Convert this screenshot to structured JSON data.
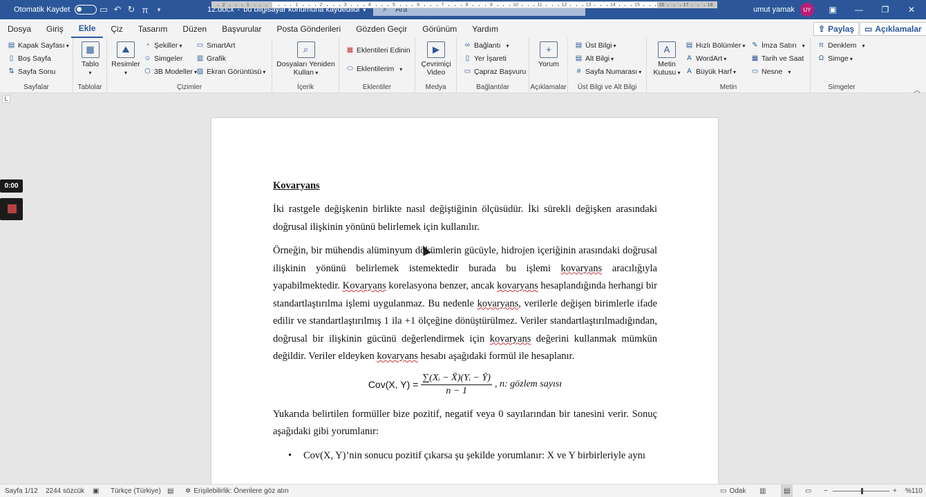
{
  "titlebar": {
    "autosave_label": "Otomatik Kaydet",
    "filename": "12.docx",
    "separator": "-",
    "save_status": "bu bilgisayar konumuna kaydedildi",
    "search_placeholder": "Ara",
    "user_name": "umut yamak",
    "user_initials": "UY",
    "colors": {
      "brand": "#2b579a",
      "avatar": "#b91d77"
    }
  },
  "menu": {
    "tabs": [
      "Dosya",
      "Giriş",
      "Ekle",
      "Çiz",
      "Tasarım",
      "Düzen",
      "Başvurular",
      "Posta Gönderileri",
      "Gözden Geçir",
      "Görünüm",
      "Yardım"
    ],
    "active_tab": "Ekle",
    "share_label": "Paylaş",
    "comments_label": "Açıklamalar"
  },
  "ribbon": {
    "pages": {
      "cover": "Kapak Sayfası",
      "blank": "Boş Sayfa",
      "break": "Sayfa Sonu",
      "label": "Sayfalar"
    },
    "tables": {
      "table": "Tablo",
      "label": "Tablolar"
    },
    "illustrations": {
      "pictures": "Resimler",
      "shapes": "Şekiller",
      "icons": "Simgeler",
      "models": "3B Modeller",
      "smartart": "SmartArt",
      "chart": "Grafik",
      "screenshot": "Ekran Görüntüsü",
      "label": "Çizimler"
    },
    "reuse": {
      "line1": "Dosyaları Yeniden",
      "line2": "Kullan",
      "label": "İçerik"
    },
    "addins": {
      "get": "Eklentileri Edinin",
      "my": "Eklentilerim",
      "label": "Eklentiler"
    },
    "media": {
      "line1": "Çevrimiçi",
      "line2": "Video",
      "label": "Medya"
    },
    "links": {
      "link": "Bağlantı",
      "bookmark": "Yer İşareti",
      "crossref": "Çapraz Başvuru",
      "label": "Bağlantılar"
    },
    "comments": {
      "comment": "Yorum",
      "label": "Açıklamalar"
    },
    "headerfooter": {
      "header": "Üst Bilgi",
      "footer": "Alt Bilgi",
      "pagenum": "Sayfa Numarası",
      "label": "Üst Bilgi ve Alt Bilgi"
    },
    "text": {
      "textbox1": "Metin",
      "textbox2": "Kutusu",
      "quickparts": "Hızlı Bölümler",
      "wordart": "WordArt",
      "dropcap": "Büyük Harf",
      "signature": "İmza Satırı",
      "datetime": "Tarih ve Saat",
      "object": "Nesne",
      "label": "Metin"
    },
    "symbols": {
      "equation": "Denklem",
      "symbol": "Simge",
      "label": "Simgeler"
    }
  },
  "ruler": {
    "tab_marker": "L",
    "numbers": [
      "2",
      "1",
      "1",
      "2",
      "3",
      "4",
      "5",
      "6",
      "7",
      "8",
      "9",
      "10",
      "11",
      "12",
      "13",
      "14",
      "15",
      "16",
      "17",
      "18"
    ]
  },
  "document": {
    "heading": "Kovaryans",
    "p1": "İki rastgele değişkenin birlikte nasıl değiştiğinin ölçüsüdür. İki sürekli değişken arasındaki doğrusal ilişkinin yönünü belirlemek için kullanılır.",
    "p2": {
      "a": "Örneğin, bir mühendis alüminyum döküm­lerin gücüyle, hidrojen içeriğinin arasındaki doğrusal ilişkinin yönünü belirlemek istemektedir burada bu işlemi ",
      "w1": "kovaryans",
      "b": " aracılığıyla yapabilmektedir. ",
      "w2": "Kovaryans",
      "c": " korelasyona benzer, ancak ",
      "w3": "kovaryans",
      "d": " hesaplandığında herhangi bir standartlaştırılma işlemi uygulanmaz. Bu nedenle ",
      "w4": "kovaryans",
      "e": ", verilerle değişen birimlerle ifade edilir ve standartlaştırılmış 1 ila +1 ölçeğine dönüştürülmez. Veriler standartlaştırılmadığından, doğrusal bir ilişkinin gücünü değerlendirmek için ",
      "w5": "kovaryans",
      "f": " değerini kullanmak mümkün değildir. Veriler eldeyken ",
      "w6": "kovaryans",
      "g": " hesabı aşağıdaki formül ile hesaplanır."
    },
    "formula": {
      "lhs": "Cov(X, Y) =",
      "numerator": "∑(Xᵢ − X̄)(Yᵢ − Ȳ)",
      "denominator": "n − 1",
      "rhs": ", n: gözlem sayısı"
    },
    "p3": "Yukarıda belirtilen formüller bize pozitif, negatif veya 0 sayılarından bir tanesini verir. Sonuç aşağıdaki gibi yorumlanır:",
    "bullet1": "Cov(X, Y)’nin sonucu pozitif çıkarsa şu şekilde yorumlanır: X ve Y birbirleriyle aynı"
  },
  "overlay": {
    "timer": "0:00"
  },
  "statusbar": {
    "page": "Sayfa 1/12",
    "words": "2244 sözcük",
    "language": "Türkçe (Türkiye)",
    "accessibility": "Erişilebilirlik: Önerilere göz atın",
    "focus": "Odak",
    "zoom": "%110"
  }
}
